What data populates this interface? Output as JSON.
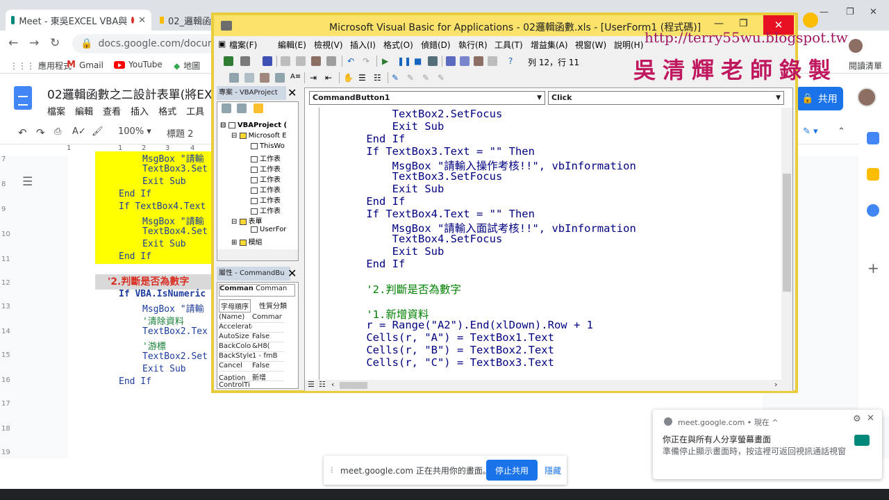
{
  "browser": {
    "tabs": [
      {
        "label": "Meet - 東吳EXCEL VBA與"
      },
      {
        "label": "02_邏輯函"
      }
    ],
    "url": "docs.google.com/documen",
    "bookmarks": [
      {
        "label": "應用程式"
      },
      {
        "label": "Gmail"
      },
      {
        "label": "YouTube"
      },
      {
        "label": "地圖"
      }
    ],
    "reading_list": "閱讀清單"
  },
  "docs": {
    "title": "02邏輯函數之二設計表單(將EXC",
    "menu": [
      "檔案",
      "編輯",
      "查看",
      "插入",
      "格式",
      "工具"
    ],
    "zoom": "100%",
    "style": "標題 2",
    "share_label": "共用",
    "ruler": [
      "1",
      "1",
      "2",
      "3",
      "4"
    ],
    "line_numbers": [
      "7",
      "8",
      "9",
      "10",
      "11",
      "12",
      "13",
      "14",
      "15",
      "16",
      "17",
      "18",
      "19"
    ],
    "code_lines": [
      {
        "text": "MsgBox \"請輸",
        "indent": 2,
        "highlight": true
      },
      {
        "text": "TextBox3.Set",
        "indent": 2,
        "highlight": true
      },
      {
        "text": "Exit Sub",
        "indent": 2,
        "highlight": true
      },
      {
        "text": "End If",
        "indent": 1,
        "highlight": true
      },
      {
        "text": "If TextBox4.Text",
        "indent": 1,
        "highlight": true
      },
      {
        "text": "MsgBox \"請輸",
        "indent": 2,
        "highlight": true
      },
      {
        "text": "TextBox4.Set",
        "indent": 2,
        "highlight": true
      },
      {
        "text": "Exit Sub",
        "indent": 2,
        "highlight": true
      },
      {
        "text": "End If",
        "indent": 1,
        "highlight": true
      }
    ],
    "heading": "'2.判斷是否為數字",
    "code_lines2": [
      {
        "text": "If VBA.IsNumeric",
        "indent": 1,
        "green": false
      },
      {
        "text": "MsgBox \"請輸",
        "indent": 2,
        "green": false
      },
      {
        "text": "'清除資料",
        "indent": 2,
        "green": true
      },
      {
        "text": "TextBox2.Tex",
        "indent": 2,
        "green": false
      },
      {
        "text": "'游標",
        "indent": 2,
        "green": true
      },
      {
        "text": "TextBox2.Set",
        "indent": 2,
        "green": false
      },
      {
        "text": "Exit Sub",
        "indent": 2,
        "green": false
      },
      {
        "text": "End If",
        "indent": 1,
        "green": false
      }
    ]
  },
  "vbe": {
    "title": "Microsoft Visual Basic for Applications - 02邏輯函數.xls - [UserForm1 (程式碼)]",
    "menus": [
      "檔案(F)",
      "編輯(E)",
      "檢視(V)",
      "插入(I)",
      "格式(O)",
      "偵錯(D)",
      "執行(R)",
      "工具(T)",
      "增益集(A)",
      "視窗(W)",
      "說明(H)"
    ],
    "position": "列 12，行 11",
    "project_pane": {
      "title": "專案 - VBAProject",
      "items": [
        {
          "label": "VBAProject (",
          "level": 0,
          "bold": true
        },
        {
          "label": "Microsoft E",
          "level": 1
        },
        {
          "label": "ThisWo",
          "level": 2
        },
        {
          "label": "工作表",
          "level": 2
        },
        {
          "label": "工作表",
          "level": 2
        },
        {
          "label": "工作表",
          "level": 2
        },
        {
          "label": "工作表",
          "level": 2
        },
        {
          "label": "工作表",
          "level": 2
        },
        {
          "label": "工作表",
          "level": 2
        },
        {
          "label": "表單",
          "level": 1
        },
        {
          "label": "UserFor",
          "level": 2
        },
        {
          "label": "模組",
          "level": 1
        }
      ]
    },
    "properties_pane": {
      "title": "屬性 - CommandBu",
      "object": "Comman",
      "object_type": "Comman",
      "tabs": [
        "字母順序",
        "性質分類"
      ],
      "rows": [
        {
          "name": "(Name)",
          "value": "Commar"
        },
        {
          "name": "Accelerato",
          "value": ""
        },
        {
          "name": "AutoSize",
          "value": "False"
        },
        {
          "name": "BackColo",
          "value": "&H8("
        },
        {
          "name": "BackStyle",
          "value": "1 - fmB"
        },
        {
          "name": "Cancel",
          "value": "False"
        },
        {
          "name": "Caption",
          "value": "新增"
        },
        {
          "name": "ControlTi",
          "value": ""
        }
      ]
    },
    "object_combo": "CommandButton1",
    "proc_combo": "Click",
    "code": [
      {
        "text": "        TextBox2.SetFocus",
        "type": "code"
      },
      {
        "text": "        Exit Sub",
        "type": "code"
      },
      {
        "text": "    End If",
        "type": "code"
      },
      {
        "text": "    If TextBox3.Text = \"\" Then",
        "type": "code"
      },
      {
        "text": "        MsgBox \"請輸入操作考核!!\", vbInformation",
        "type": "code"
      },
      {
        "text": "        TextBox3.SetFocus",
        "type": "code"
      },
      {
        "text": "        Exit Sub",
        "type": "code"
      },
      {
        "text": "    End If",
        "type": "code"
      },
      {
        "text": "    If TextBox4.Text = \"\" Then",
        "type": "code"
      },
      {
        "text": "        MsgBox \"請輸入面試考核!!\", vbInformation",
        "type": "code"
      },
      {
        "text": "        TextBox4.SetFocus",
        "type": "code"
      },
      {
        "text": "        Exit Sub",
        "type": "code"
      },
      {
        "text": "    End If",
        "type": "code"
      },
      {
        "text": "",
        "type": "code"
      },
      {
        "text": "    '2.判斷是否為數字",
        "type": "comment"
      },
      {
        "text": "",
        "type": "code"
      },
      {
        "text": "    '1.新增資料",
        "type": "comment"
      },
      {
        "text": "    r = Range(\"A2\").End(xlDown).Row + 1",
        "type": "code"
      },
      {
        "text": "    Cells(r, \"A\") = TextBox1.Text",
        "type": "code"
      },
      {
        "text": "    Cells(r, \"B\") = TextBox2.Text",
        "type": "code"
      },
      {
        "text": "    Cells(r, \"C\") = TextBox3.Text",
        "type": "code"
      }
    ]
  },
  "watermark": {
    "url": "http://terry55wu.blogspot.tw",
    "name": "吳清輝老師錄製"
  },
  "meet": {
    "share_text": "meet.google.com 正在共用你的畫面。",
    "stop_label": "停止共用",
    "hide_label": "隱藏",
    "notif_source": "meet.google.com • 現在 ^",
    "notif_title": "你正在與所有人分享螢幕畫面",
    "notif_body": "準備停止顯示畫面時，按這裡可返回視訊通話視窗"
  },
  "colors": {
    "highlight": "#ffff00",
    "vbe_border": "#e8cc3c",
    "code_keyword": "#000080",
    "code_comment": "#008000",
    "accent": "#1a73e8"
  }
}
